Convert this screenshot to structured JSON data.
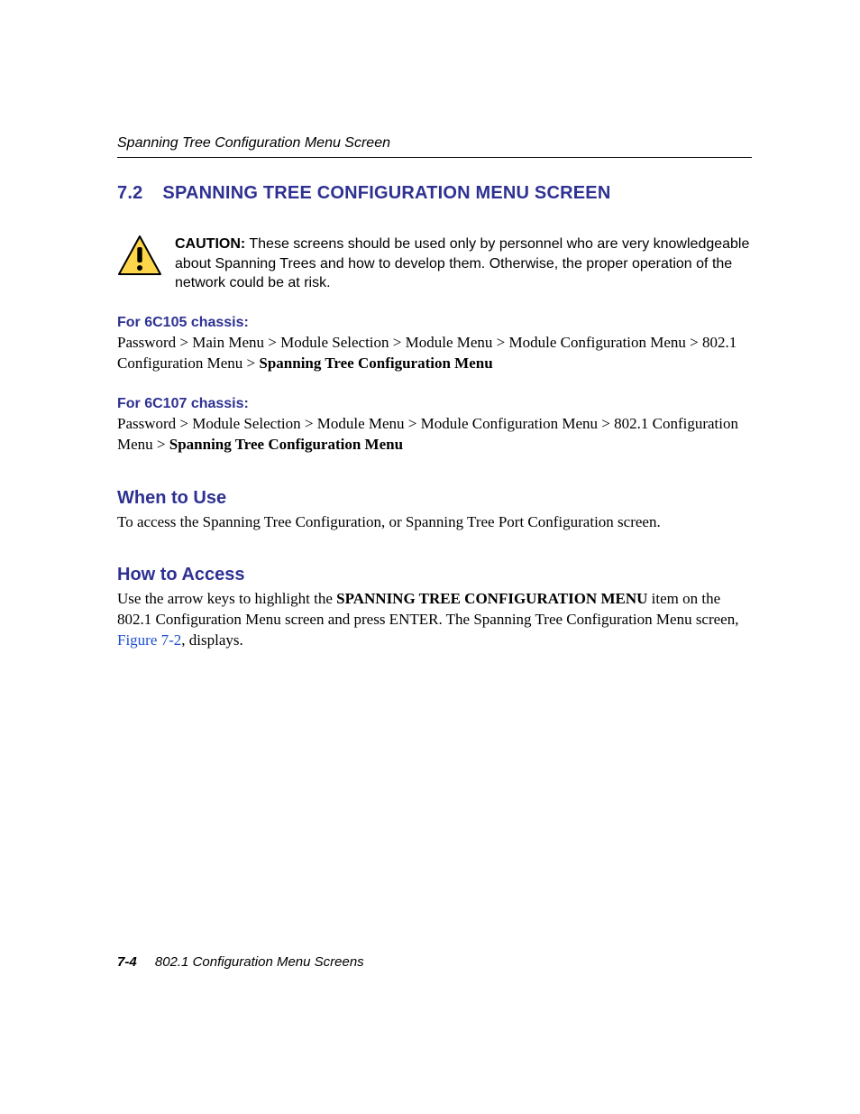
{
  "header": {
    "running_title": "Spanning Tree Configuration Menu Screen"
  },
  "section": {
    "number": "7.2",
    "title": "SPANNING TREE CONFIGURATION MENU SCREEN"
  },
  "caution": {
    "label": "CAUTION:",
    "text": "These screens should be used only by personnel who are very knowledgeable about Spanning Trees and how to develop them. Otherwise, the proper operation of the network could be at risk."
  },
  "chassis105": {
    "heading": "For 6C105 chassis:",
    "path_prefix": "Password > Main Menu > Module Selection > Module Menu > Module Configuration Menu > 802.1 Configuration Menu > ",
    "path_bold": "Spanning Tree Configuration Menu"
  },
  "chassis107": {
    "heading": "For 6C107 chassis:",
    "path_prefix": "Password > Module Selection > Module Menu > Module Configuration Menu > 802.1 Configuration Menu > ",
    "path_bold": "Spanning Tree Configuration Menu"
  },
  "when_to_use": {
    "heading": "When to Use",
    "text": "To access the Spanning Tree Configuration, or Spanning Tree Port Configuration screen."
  },
  "how_to_access": {
    "heading": "How to Access",
    "pre": "Use the arrow keys to highlight the ",
    "bold": "SPANNING TREE CONFIGURATION MENU",
    "mid": " item on the 802.1 Configuration Menu screen and press ENTER. The Spanning Tree Configuration Menu screen, ",
    "link": "Figure 7-2",
    "post": ", displays."
  },
  "footer": {
    "page": "7-4",
    "title": "802.1 Configuration Menu Screens"
  }
}
